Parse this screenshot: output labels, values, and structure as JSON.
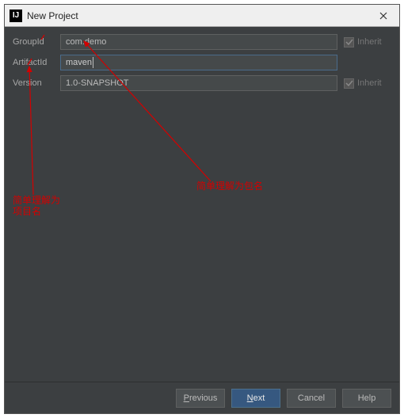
{
  "window": {
    "title": "New Project",
    "icon_label": "IJ"
  },
  "form": {
    "groupId": {
      "label": "GroupId",
      "value": "com.demo"
    },
    "artifactId": {
      "label": "ArtifactId",
      "value": "maven"
    },
    "version": {
      "label": "Version",
      "value": "1.0-SNAPSHOT"
    },
    "inherit_label": "Inherit"
  },
  "buttons": {
    "previous": "Previous",
    "next": "Next",
    "cancel": "Cancel",
    "help": "Help"
  },
  "annotations": {
    "package_hint": "简单理解为包名",
    "project_hint_line1": "简单理解为",
    "project_hint_line2": "项目名"
  },
  "colors": {
    "accent": "#365880",
    "annotation": "#d40000"
  }
}
